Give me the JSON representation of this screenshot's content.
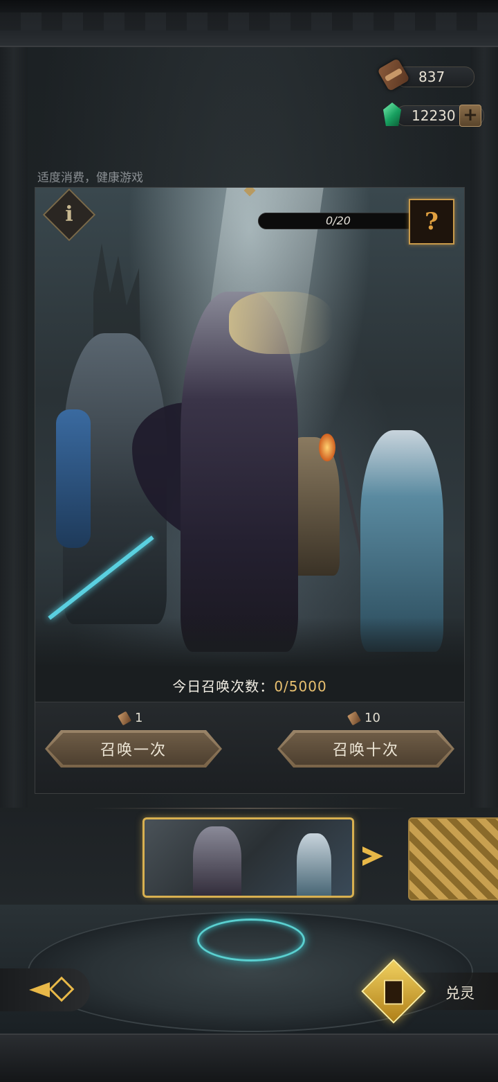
{
  "currencies": {
    "scroll": {
      "icon": "scroll-icon",
      "value": "837"
    },
    "gem": {
      "icon": "gem-icon",
      "value": "12230",
      "add_label": "+"
    }
  },
  "notice": "适度消费，健康游戏",
  "banner": {
    "info_glyph": "i",
    "progress_text": "0/20",
    "mystery_glyph": "?",
    "daily_label": "今日召唤次数：",
    "daily_count": "0/5000"
  },
  "summon": {
    "single": {
      "cost": "1",
      "label": "召唤一次"
    },
    "ten": {
      "cost": "10",
      "label": "召唤十次"
    }
  },
  "bottom": {
    "exchange_label": "兑灵"
  },
  "colors": {
    "accent_gold": "#d8b050",
    "rune_cyan": "#5ad0d0"
  }
}
